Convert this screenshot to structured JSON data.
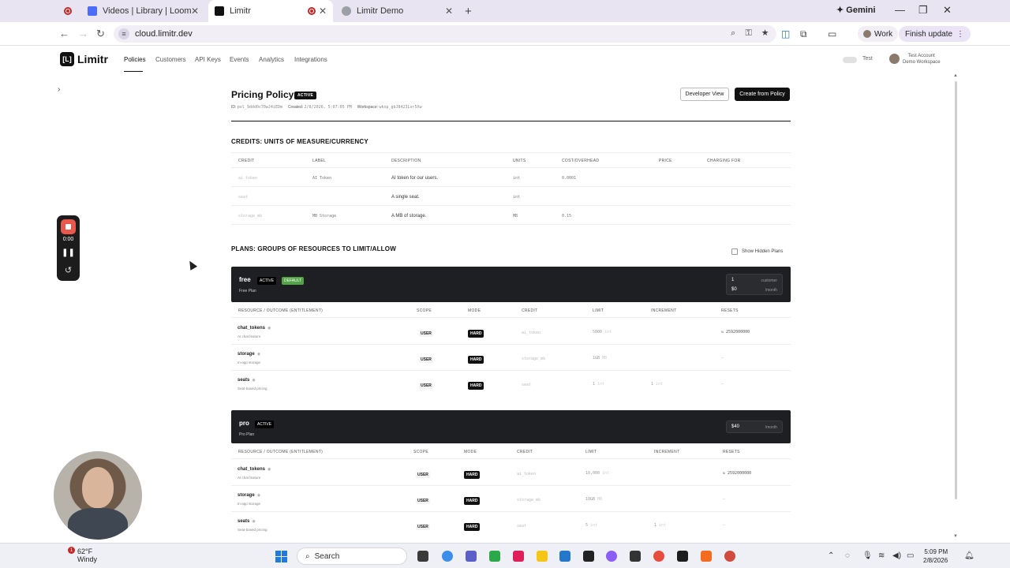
{
  "browser": {
    "tabs": [
      {
        "title": "Videos | Library | Loom",
        "active": false
      },
      {
        "title": "Limitr",
        "active": true
      },
      {
        "title": "Limitr Demo",
        "active": false
      }
    ],
    "new_tab": "+",
    "gemini": "Gemini",
    "url": "cloud.limitr.dev",
    "profile": "Work",
    "finish_update": "Finish update"
  },
  "app": {
    "brand": "Limitr",
    "nav": [
      "Policies",
      "Customers",
      "API Keys",
      "Events",
      "Analytics",
      "Integrations"
    ],
    "active_nav": "Policies",
    "test_label": "Test",
    "account_name": "Test Account",
    "workspace_name": "Demo Workspace"
  },
  "recorder": {
    "time": "0:00"
  },
  "policy": {
    "title": "Pricing Policy",
    "status": "ACTIVE",
    "id_label": "ID:",
    "id_value": "pol_9ddd0c70wJ4iEDm",
    "created_label": "Created:",
    "created_value": "2/8/2026, 5:07:05 PM",
    "workspace_label": "Workspace:",
    "workspace_value": "wksp_gbJ8423Lvr5Xw",
    "developer_view": "Developer View",
    "create_from_policy": "Create from Policy"
  },
  "credits": {
    "section_title": "CREDITS: UNITS OF MEASURE/CURRENCY",
    "headers": [
      "CREDIT",
      "LABEL",
      "DESCRIPTION",
      "UNITS",
      "COST/OVERHEAD",
      "PRICE",
      "CHARGING FOR"
    ],
    "rows": [
      {
        "credit": "ai_token",
        "label": "AI Token",
        "description": "AI token for our users.",
        "units": "int",
        "cost": "0.0001"
      },
      {
        "credit": "seat",
        "label": "",
        "description": "A single seat.",
        "units": "int",
        "cost": ""
      },
      {
        "credit": "storage_mb",
        "label": "MB Storage",
        "description": "A MB of storage.",
        "units": "MB",
        "cost": "0.15"
      }
    ]
  },
  "plans": {
    "section_title": "PLANS: GROUPS OF RESOURCES TO LIMIT/ALLOW",
    "show_hidden": "Show Hidden Plans",
    "headers": [
      "RESOURCE / OUTCOME (ENTITLEMENT)",
      "SCOPE",
      "MODE",
      "CREDIT",
      "LIMIT",
      "INCREMENT",
      "RESETS"
    ],
    "list": [
      {
        "name": "free",
        "status": "ACTIVE",
        "default_badge": "DEFAULT",
        "subtitle": "Free Plan",
        "price_qty": "1",
        "price_qty_unit": "customer",
        "price": "$0",
        "price_unit": "/month",
        "rows": [
          {
            "name": "chat_tokens",
            "sub": "AI chat feature",
            "scope": "USER",
            "mode": "HARD",
            "credit": "ai_token",
            "limit": "5000",
            "limit_unit": "int",
            "increment": "",
            "resets": "2592000000"
          },
          {
            "name": "storage",
            "sub": "In-app storage",
            "scope": "USER",
            "mode": "HARD",
            "credit": "storage_mb",
            "limit": "1GB",
            "limit_unit": "MB",
            "increment": "",
            "resets": "—"
          },
          {
            "name": "seats",
            "sub": "Seat-based pricing",
            "scope": "USER",
            "mode": "HARD",
            "credit": "seat",
            "limit": "1",
            "limit_unit": "int",
            "increment": "1",
            "increment_unit": "int",
            "resets": "—"
          }
        ]
      },
      {
        "name": "pro",
        "status": "ACTIVE",
        "subtitle": "Pro Plan",
        "price": "$40",
        "price_unit": "/month",
        "rows": [
          {
            "name": "chat_tokens",
            "sub": "AI chat feature",
            "scope": "USER",
            "mode": "HARD",
            "credit": "ai_token",
            "limit": "10,000",
            "limit_unit": "int",
            "increment": "",
            "resets": "2592000000"
          },
          {
            "name": "storage",
            "sub": "In-app storage",
            "scope": "USER",
            "mode": "HARD",
            "credit": "storage_mb",
            "limit": "10GB",
            "limit_unit": "MB",
            "increment": "",
            "resets": "—"
          },
          {
            "name": "seats",
            "sub": "Seat-based pricing",
            "scope": "USER",
            "mode": "HARD",
            "credit": "seat",
            "limit": "5",
            "limit_unit": "int",
            "increment": "1",
            "increment_unit": "int",
            "resets": "—"
          }
        ]
      }
    ]
  },
  "taskbar": {
    "temp": "62°F",
    "weather": "Windy",
    "notif_count": "1",
    "search": "Search",
    "time": "5:09 PM",
    "date": "2/8/2026"
  }
}
